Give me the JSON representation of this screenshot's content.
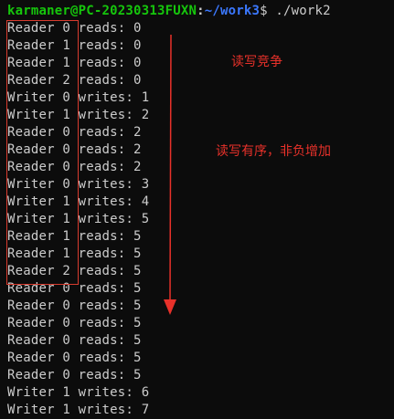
{
  "terminal": {
    "prompt": {
      "user_host": "karmaner@PC-20230313FUXN",
      "separator": ":",
      "path": "~/work3",
      "dollar": "$",
      "command": " ./work2"
    },
    "lines": [
      "Reader 0 reads: 0",
      "Reader 1 reads: 0",
      "Reader 1 reads: 0",
      "Reader 2 reads: 0",
      "Writer 0 writes: 1",
      "Writer 1 writes: 2",
      "Reader 0 reads: 2",
      "Reader 0 reads: 2",
      "Reader 0 reads: 2",
      "Writer 0 writes: 3",
      "Writer 1 writes: 4",
      "Writer 1 writes: 5",
      "Reader 1 reads: 5",
      "Reader 1 reads: 5",
      "Reader 2 reads: 5",
      "Reader 0 reads: 5",
      "Reader 0 reads: 5",
      "Reader 0 reads: 5",
      "Reader 0 reads: 5",
      "Reader 0 reads: 5",
      "Reader 0 reads: 5",
      "Writer 1 writes: 6",
      "Writer 1 writes: 7"
    ]
  },
  "annotations": {
    "race_label": "读写竞争",
    "order_label": "读写有序，非负增加",
    "color": "#e8312a"
  },
  "colors": {
    "background": "#0c0c0c",
    "text": "#cccccc",
    "prompt_user": "#16c60c",
    "prompt_path": "#3b78ff",
    "highlight_box": "#d83b2e",
    "arrow": "#e8312a"
  }
}
